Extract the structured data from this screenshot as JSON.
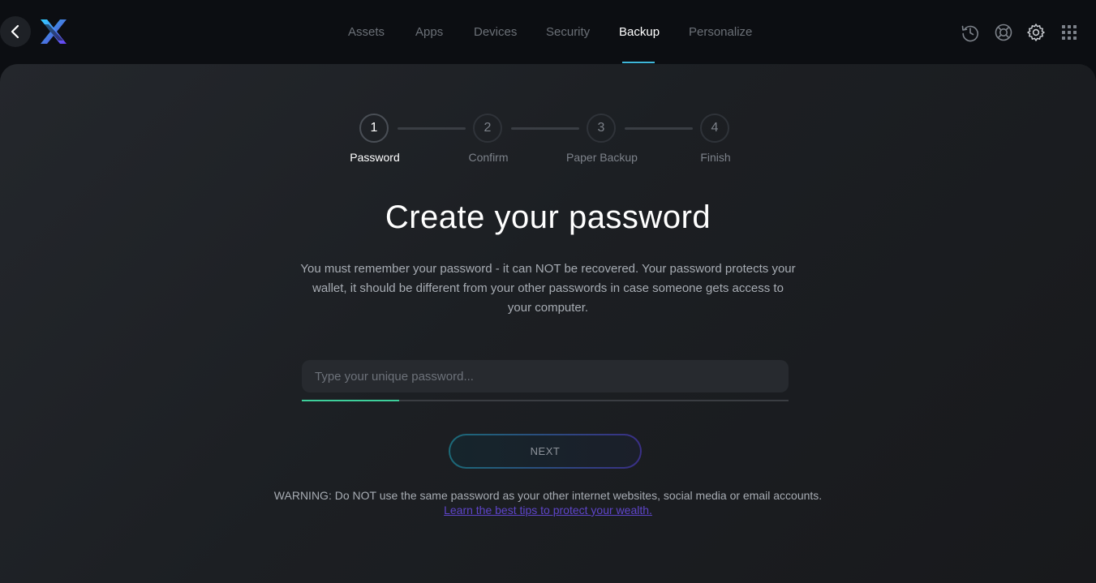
{
  "nav": {
    "items": [
      {
        "label": "Assets"
      },
      {
        "label": "Apps"
      },
      {
        "label": "Devices"
      },
      {
        "label": "Security"
      },
      {
        "label": "Backup",
        "active": true
      },
      {
        "label": "Personalize"
      }
    ]
  },
  "header_icons": [
    "back-arrow-icon",
    "exodus-logo",
    "history-icon",
    "help-lifebuoy-icon",
    "settings-gear-icon",
    "apps-grid-icon"
  ],
  "stepper": {
    "steps": [
      {
        "number": "1",
        "label": "Password",
        "active": true
      },
      {
        "number": "2",
        "label": "Confirm"
      },
      {
        "number": "3",
        "label": "Paper Backup"
      },
      {
        "number": "4",
        "label": "Finish"
      }
    ]
  },
  "main": {
    "title": "Create your password",
    "description": "You must remember your password - it can NOT be recovered. Your password protects your wallet, it should be different from your other passwords in case someone gets access to your computer.",
    "password_placeholder": "Type your unique password...",
    "password_value": "",
    "strength_fraction": 0.2,
    "next_label": "NEXT",
    "warning": "WARNING: Do NOT use the same password as your other internet websites, social media or email accounts.",
    "tips_link": "Learn the best tips to protect your wealth."
  },
  "colors": {
    "accent_blue": "#3fb7d9",
    "strength_green": "#3ecf9b",
    "link_purple": "#5e45c9"
  }
}
